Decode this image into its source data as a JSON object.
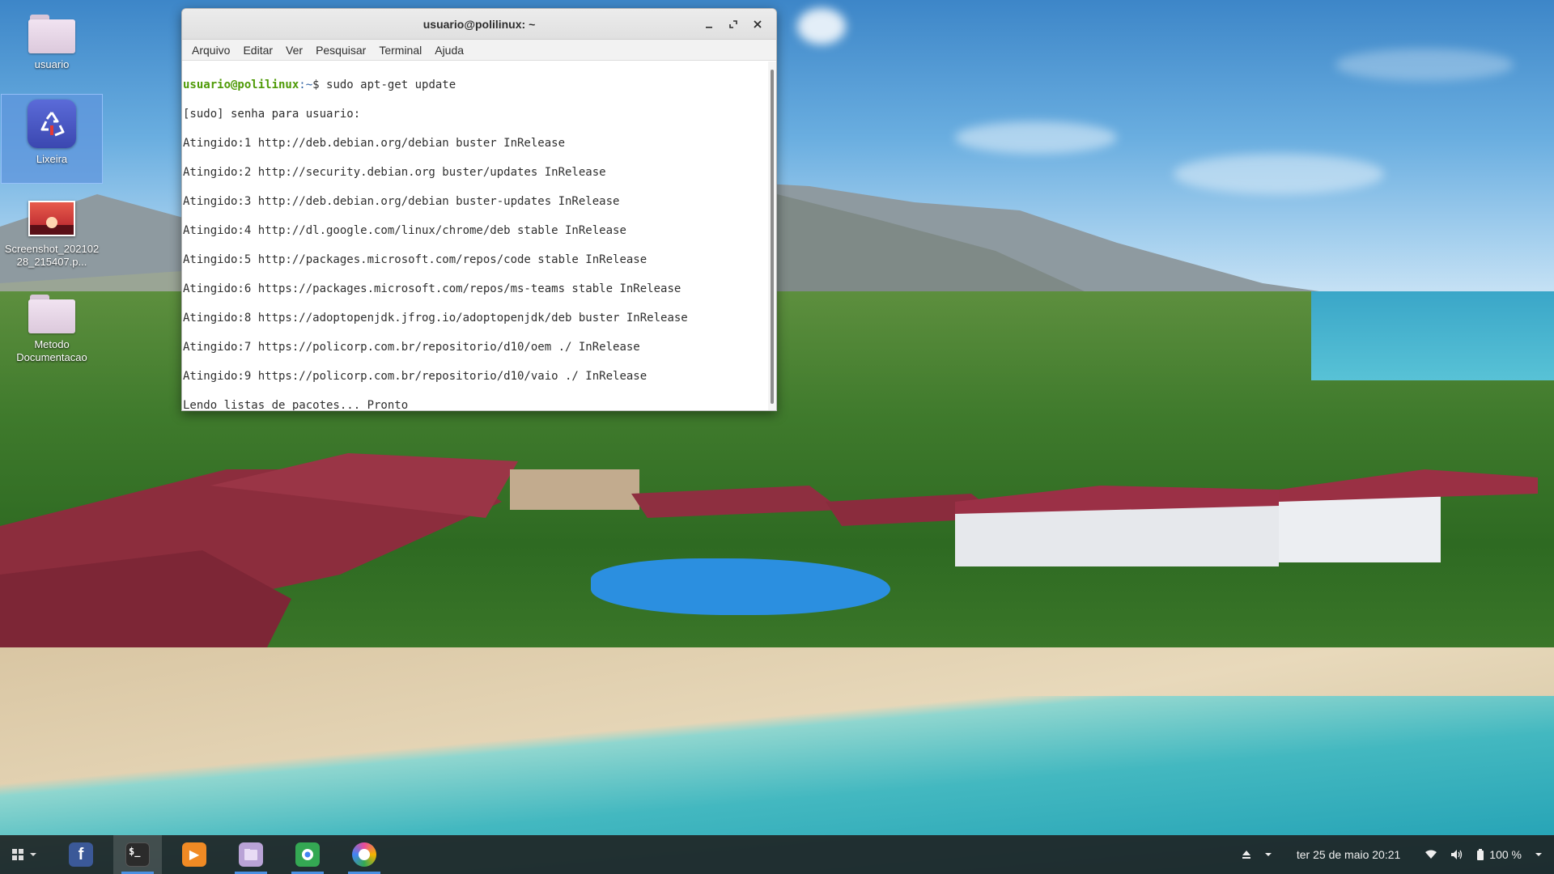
{
  "desktop": {
    "icons": [
      {
        "label": "usuario"
      },
      {
        "label": "Lixeira"
      },
      {
        "label": "Screenshot_20210228_215407.p..."
      },
      {
        "label": "Metodo Documentacao"
      }
    ]
  },
  "terminal": {
    "title": "usuario@polilinux: ~",
    "menu": [
      "Arquivo",
      "Editar",
      "Ver",
      "Pesquisar",
      "Terminal",
      "Ajuda"
    ],
    "prompt_user": "usuario@polilinux",
    "prompt_path": ":~",
    "prompt_symbol": "$ ",
    "command": "sudo apt-get update",
    "output": [
      "[sudo] senha para usuario:",
      "Atingido:1 http://deb.debian.org/debian buster InRelease",
      "Atingido:2 http://security.debian.org buster/updates InRelease",
      "Atingido:3 http://deb.debian.org/debian buster-updates InRelease",
      "Atingido:4 http://dl.google.com/linux/chrome/deb stable InRelease",
      "Atingido:5 http://packages.microsoft.com/repos/code stable InRelease",
      "Atingido:6 https://packages.microsoft.com/repos/ms-teams stable InRelease",
      "Atingido:8 https://adoptopenjdk.jfrog.io/adoptopenjdk/deb buster InRelease",
      "Atingido:7 https://policorp.com.br/repositorio/d10/oem ./ InRelease",
      "Atingido:9 https://policorp.com.br/repositorio/d10/vaio ./ InRelease",
      "Lendo listas de pacotes... Pronto"
    ]
  },
  "taskbar": {
    "apps": [
      {
        "name": "facebook",
        "glyph": "f",
        "color": "#3b5998"
      },
      {
        "name": "terminal",
        "glyph": "$_",
        "color": "#2b2b2b"
      },
      {
        "name": "media-player",
        "glyph": "▶",
        "color": "#f08a24"
      },
      {
        "name": "files",
        "glyph": "",
        "color": "#b9a3d6"
      },
      {
        "name": "chrome-web-store",
        "glyph": "",
        "color": "#34a853"
      },
      {
        "name": "color-app",
        "glyph": "",
        "color": "#e94b9b"
      }
    ],
    "datetime": "ter 25 de maio  20:21",
    "battery": "100 %"
  }
}
